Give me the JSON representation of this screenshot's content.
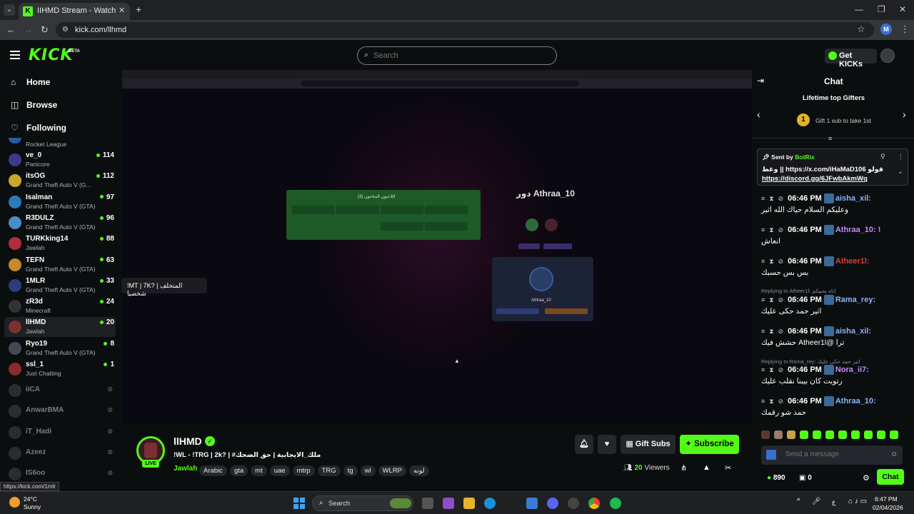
{
  "browser": {
    "tab_title": "IIHMD Stream - Watch Live on K",
    "url": "kick.com/llhmd",
    "profile_initial": "M",
    "status_link": "https://kick.com/1mlr"
  },
  "header": {
    "logo": "KICK",
    "beta": "BETA",
    "search_placeholder": "Search",
    "get_kicks_label": "Get KICKs"
  },
  "sidebar": {
    "nav": [
      {
        "label": "Home",
        "icon": "home-icon"
      },
      {
        "label": "Browse",
        "icon": "compass-icon"
      },
      {
        "label": "Following",
        "icon": "heart-icon"
      }
    ],
    "partial_category": "Rocket League",
    "channels": [
      {
        "name": "ve_0",
        "category": "Panicore",
        "viewers": "114",
        "color": "#3d3a8e"
      },
      {
        "name": "itsOG",
        "category": "Grand Theft Auto V (G...",
        "viewers": "112",
        "color": "#c8a82a"
      },
      {
        "name": "Isalman",
        "category": "Grand Theft Auto V (GTA)",
        "viewers": "97",
        "color": "#2a7ab8"
      },
      {
        "name": "R3DULZ",
        "category": "Grand Theft Auto V (GTA)",
        "viewers": "96",
        "color": "#4a8bc9"
      },
      {
        "name": "TURKking14",
        "category": "Jawlah",
        "viewers": "88",
        "color": "#b22d3a"
      },
      {
        "name": "TEFN",
        "category": "Grand Theft Auto V (GTA)",
        "viewers": "63",
        "color": "#c48a2c"
      },
      {
        "name": "1MLR",
        "category": "Grand Theft Auto V (GTA)",
        "viewers": "33",
        "color": "#2c3e7a"
      },
      {
        "name": "zR3d",
        "category": "Minecraft",
        "viewers": "24",
        "color": "#333333"
      },
      {
        "name": "llHMD",
        "category": "Jawlah",
        "viewers": "20",
        "color": "#7b2e34"
      },
      {
        "name": "Ryo19",
        "category": "Grand Theft Auto V (GTA)",
        "viewers": "8",
        "color": "#444a55"
      },
      {
        "name": "ssl_1",
        "category": "Just Chatting",
        "viewers": "1",
        "color": "#8a2a2a"
      }
    ],
    "offline": [
      "iiCA",
      "AnwarBMA",
      "iT_Hadi",
      "Azeez",
      "IS6oo"
    ],
    "tooltip": "!MT | 7K? | المتخلف شخصيا"
  },
  "video": {
    "ingame_left_title": "اللاعبون المتاحون (3)",
    "ingame_right_title": "دور Athraa_10",
    "ingame_card_name": "Athraa_10"
  },
  "stream": {
    "streamer": "llHMD",
    "live": "LIVE",
    "title": "!WL - !TRG | 2k? | #ملك_الايجابية | حق الضحك",
    "category": "Jawlah",
    "tags": [
      "Arabic",
      "gta",
      "mt",
      "uae",
      "mtrp",
      "TRG",
      "tg",
      "wl",
      "WLRP",
      "لونه"
    ],
    "gift_subs": "Gift Subs",
    "subscribe": "Subscribe",
    "viewers": "20",
    "viewers_label": "Viewers"
  },
  "chat": {
    "title": "Chat",
    "gifters_title": "Lifetime top Gifters",
    "gifter_rank": "1",
    "gifter_text": "Gift 1 sub to take 1st",
    "pinned_sent_by": "Sent by",
    "pinned_bot": "BotRix",
    "pinned_line1": "وغط || https://x.com/iHaMaD106 قولو",
    "pinned_line2": "https://discord.gg/6JFwbAkmWq",
    "messages": [
      {
        "time": "06:46 PM",
        "user": "aisha_xil:",
        "color": "#8ab4f8",
        "body": "وعليكم السلام حياك الله اثير"
      },
      {
        "time": "06:46 PM",
        "user": "Athraa_10: !",
        "color": "#c58af9",
        "body": "انعاش"
      },
      {
        "time": "06:46 PM",
        "user": "Atheer1l:",
        "color": "#e53935",
        "body": "بس بس حسبك"
      },
      {
        "time": "06:46 PM",
        "user": "Rama_rey:",
        "color": "#8ab4f8",
        "body": "اثير حمد حكى عليك"
      },
      {
        "time": "06:46 PM",
        "user": "aisha_xil:",
        "color": "#8ab4f8",
        "body": "ترا @Atheer1l حشش فيك"
      },
      {
        "time": "06:46 PM",
        "user": "Nora_ii7:",
        "color": "#c58af9",
        "body": "رتويت كان بيبنا نقلب عليك"
      },
      {
        "time": "06:46 PM",
        "user": "Athraa_10:",
        "color": "#8ab4f8",
        "body": "حمد شو رقمك"
      }
    ],
    "reply1": "Replying to Atheer1l: اتاه بحبيكم",
    "reply2": "Replying to Rama_rey: اثير حمد حكى عليك",
    "input_placeholder": "Send a message",
    "kicks_balance": "890",
    "points_balance": "0",
    "send_label": "Chat"
  },
  "taskbar": {
    "temp": "24°C",
    "weather": "Sunny",
    "search_label": "Search",
    "time": "6:47 PM",
    "date": "02/04/2026",
    "lang": "ع"
  }
}
